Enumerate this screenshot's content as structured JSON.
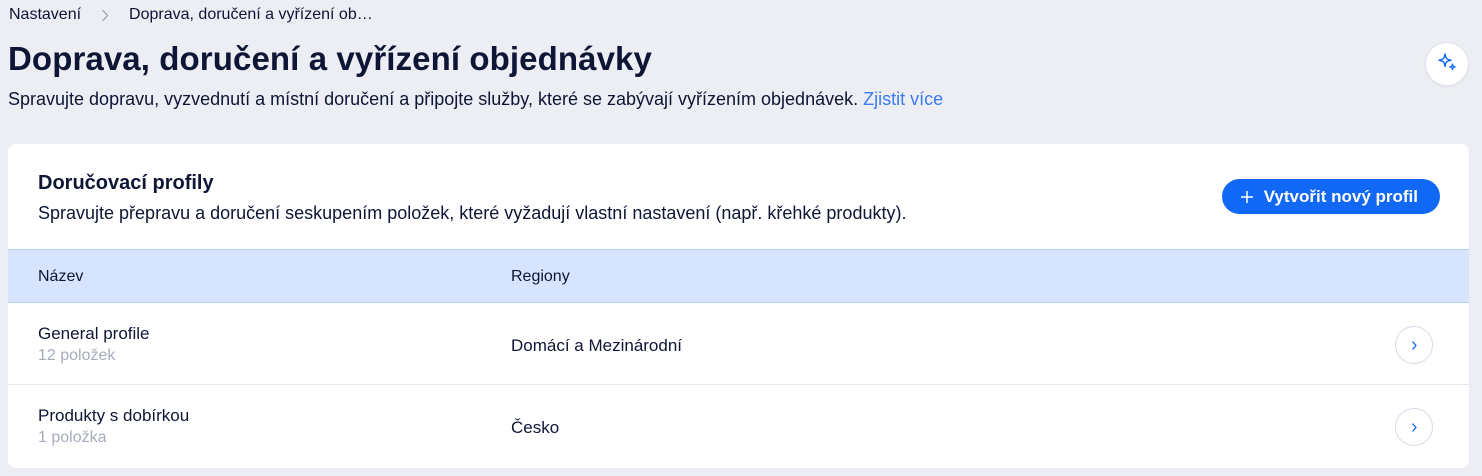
{
  "breadcrumb": {
    "parent": "Nastavení",
    "current": "Doprava, doručení a vyřízení ob…"
  },
  "header": {
    "title": "Doprava, doručení a vyřízení objednávky",
    "subtitle": "Spravujte dopravu, vyzvednutí a místní doručení a připojte služby, které se zabývají vyřízením objednávek.",
    "learn_more": "Zjistit více"
  },
  "profiles_card": {
    "title": "Doručovací profily",
    "description": "Spravujte přepravu a doručení seskupením položek, které vyžadují vlastní nastavení (např. křehké produkty).",
    "create_button": "Vytvořit nový profil",
    "columns": [
      "Název",
      "Regiony"
    ],
    "rows": [
      {
        "name": "General profile",
        "count": "12 položek",
        "regions": "Domácí a Mezinárodní"
      },
      {
        "name": "Produkty s dobírkou",
        "count": "1 položka",
        "regions": "Česko"
      }
    ]
  },
  "colors": {
    "accent": "#1168f5",
    "link": "#3b7af0",
    "table_header_bg": "#d6e5fd",
    "page_bg": "#eceef3"
  },
  "icons": {
    "breadcrumb_separator": "chevron-right-icon",
    "ai_assistant": "sparkle-icon",
    "create": "plus-icon",
    "row_open": "chevron-right-icon"
  }
}
